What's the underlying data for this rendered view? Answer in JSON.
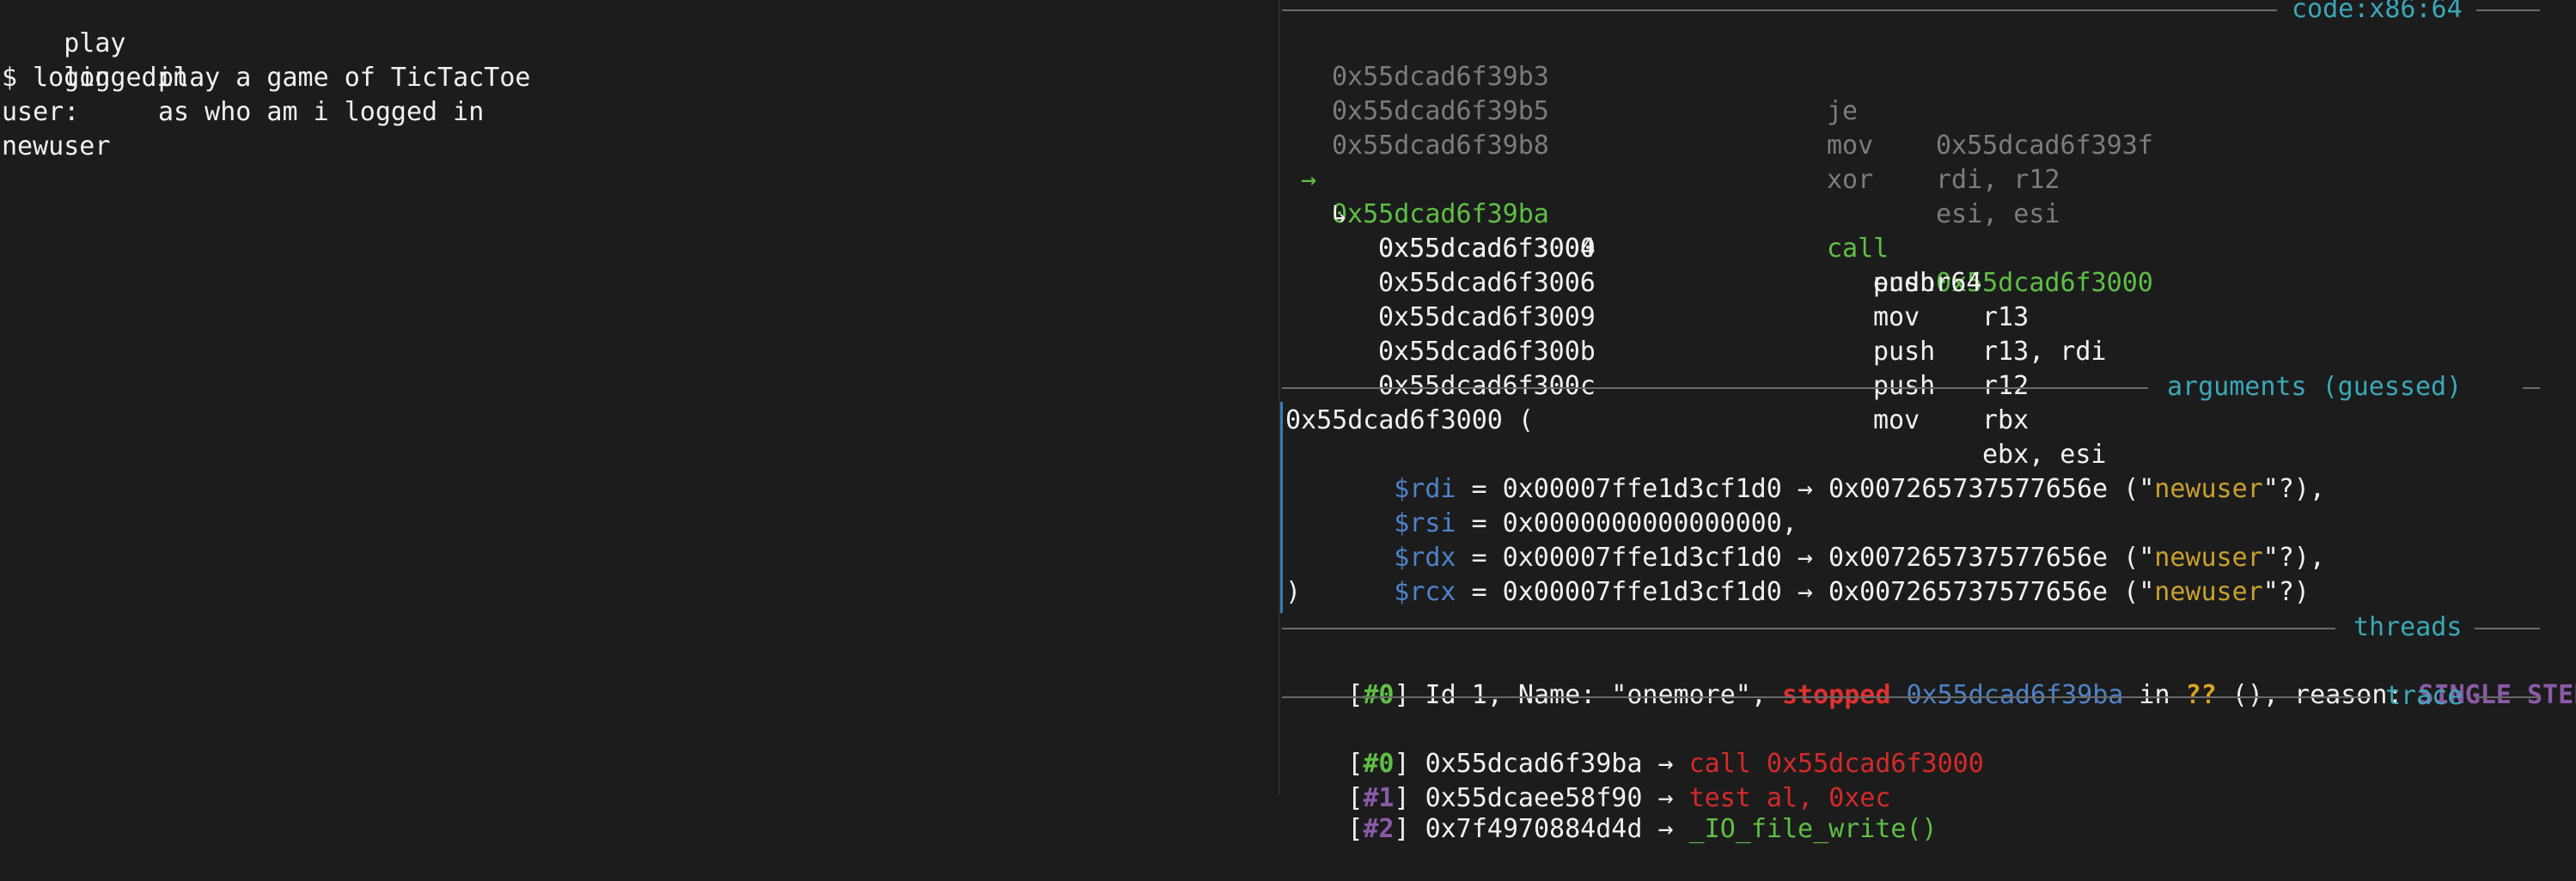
{
  "terminal": {
    "lines": [
      {
        "cmd": "play",
        "desc": "play a game of TicTacToe"
      },
      {
        "cmd": "loggedin",
        "desc": "as who am i logged in"
      },
      {
        "text": "$ login"
      },
      {
        "text": "user:"
      },
      {
        "text": "newuser"
      }
    ]
  },
  "code": {
    "header": "code:x86:64",
    "past": [
      {
        "addr": "0x55dcad6f39b3",
        "mnem": "je",
        "ops": "0x55dcad6f393f"
      },
      {
        "addr": "0x55dcad6f39b5",
        "mnem": "mov",
        "ops": "rdi, r12"
      },
      {
        "addr": "0x55dcad6f39b8",
        "mnem": "xor",
        "ops": "esi, esi"
      }
    ],
    "current": {
      "arrow": "→",
      "addr": "0x55dcad6f39ba",
      "mnem": "call",
      "ops": "0x55dcad6f3000"
    },
    "target_marker": "↳",
    "target": [
      {
        "addr": "0x55dcad6f3000",
        "mnem": "endbr64",
        "ops": ""
      },
      {
        "addr": "0x55dcad6f3004",
        "mnem": "push",
        "ops": "r13"
      },
      {
        "addr": "0x55dcad6f3006",
        "mnem": "mov",
        "ops": "r13, rdi"
      },
      {
        "addr": "0x55dcad6f3009",
        "mnem": "push",
        "ops": "r12"
      },
      {
        "addr": "0x55dcad6f300b",
        "mnem": "push",
        "ops": "rbx"
      },
      {
        "addr": "0x55dcad6f300c",
        "mnem": "mov",
        "ops": "ebx, esi"
      }
    ]
  },
  "arguments": {
    "header": "arguments (guessed)",
    "open": "0x55dcad6f3000 (",
    "close": ")",
    "args": [
      {
        "reg": "$rdi",
        "pre": " = 0x00007ffe1d3cf1d0 → 0x007265737577656e (\"",
        "str": "newuser",
        "post": "\"?),"
      },
      {
        "reg": "$rsi",
        "pre": " = 0x0000000000000000,",
        "str": "",
        "post": ""
      },
      {
        "reg": "$rdx",
        "pre": " = 0x00007ffe1d3cf1d0 → 0x007265737577656e (\"",
        "str": "newuser",
        "post": "\"?),"
      },
      {
        "reg": "$rcx",
        "pre": " = 0x00007ffe1d3cf1d0 → 0x007265737577656e (\"",
        "str": "newuser",
        "post": "\"?)"
      }
    ]
  },
  "threads": {
    "header": "threads",
    "lbr": "[",
    "idx": "#0",
    "rbr": "] Id 1, Name: \"onemore\", ",
    "state": "stopped",
    "addr": "0x55dcad6f39ba",
    "in": " in ",
    "func": "??",
    "rest": " (), reason: ",
    "reason": "SINGLE STEP"
  },
  "trace": {
    "header": "trace",
    "frames": [
      {
        "idx": "#0",
        "addr": "0x55dcad6f39ba",
        "arrow": " → ",
        "insn": "call 0x55dcad6f3000",
        "insn_color": "red"
      },
      {
        "idx": "#1",
        "addr": "0x55dcaee58f90",
        "arrow": " → ",
        "insn": "test al, 0xec",
        "insn_color": "red"
      },
      {
        "idx": "#2",
        "addr": "0x7f4970884d4d",
        "arrow": " → ",
        "insn": "_IO_file_write()",
        "insn_color": "green"
      }
    ]
  },
  "colors": {
    "background": "#1c1c1c",
    "header_cyan": "#3aa8b8",
    "current_green": "#5fbf45",
    "register_blue": "#4e83c8",
    "string_yellow": "#c8a030",
    "stopped_red": "#e03030",
    "reason_purple": "#8a5aa8"
  }
}
